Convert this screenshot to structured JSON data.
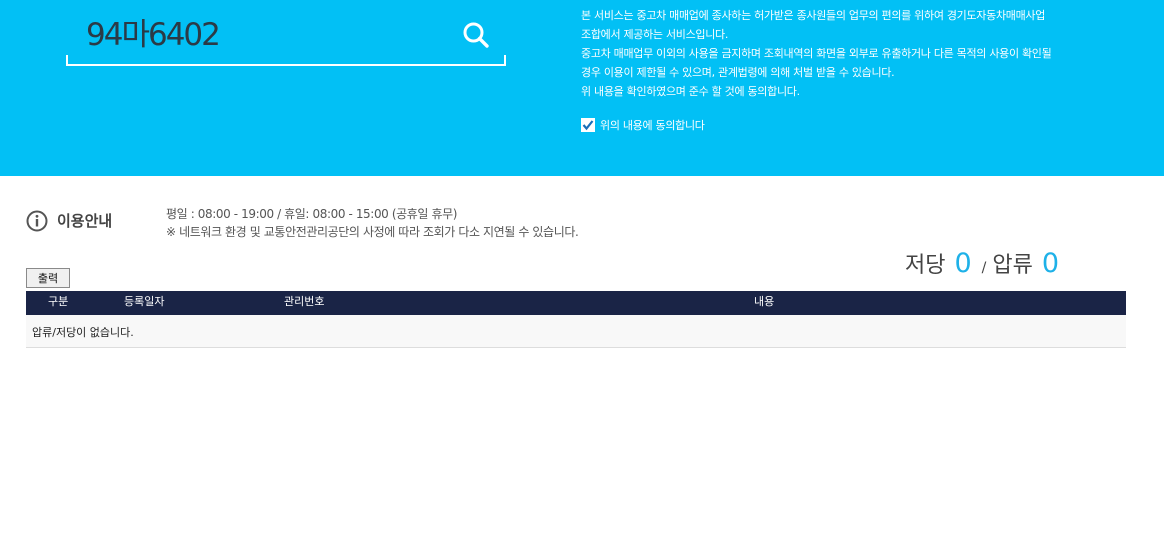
{
  "search": {
    "value": "94마6402"
  },
  "notice": {
    "lines": [
      "본 서비스는 중고차 매매업에 종사하는 허가받은 종사원들의 업무의 편의를 위하여 경기도자동차매매사업",
      "조합에서 제공하는 서비스입니다.",
      "중고차 매매업무 이외의 사용을 금지하며 조회내역의 화면을 외부로 유출하거나 다른 목적의 사용이 확인될",
      "경우 이용이 제한될 수 있으며, 관계법령에 의해 처벌 받을 수 있습니다.",
      "위 내용을 확인하였으며 준수 할 것에 동의합니다."
    ],
    "agree_label": "위의 내용에 동의합니다",
    "agree_checked": true
  },
  "info": {
    "title": "이용안내",
    "hours": "평일 : 08:00 - 19:00 / 휴일: 08:00 - 15:00 (공휴일 휴무)",
    "note": "※ 네트워크 환경 및 교통안전관리공단의 사정에 따라 조회가 다소 지연될 수 있습니다."
  },
  "counter": {
    "mortgage_label": "저당",
    "mortgage_count": "0",
    "separator": "/",
    "seizure_label": "압류",
    "seizure_count": "0"
  },
  "toolbar": {
    "print_label": "출력"
  },
  "table": {
    "columns": [
      "구분",
      "등록일자",
      "관리번호",
      "내용"
    ],
    "empty_message": "압류/저당이 없습니다."
  },
  "colors": {
    "hero_bg": "#02c0f5",
    "table_header_bg": "#1a2446",
    "accent_number": "#1eb1e8"
  }
}
